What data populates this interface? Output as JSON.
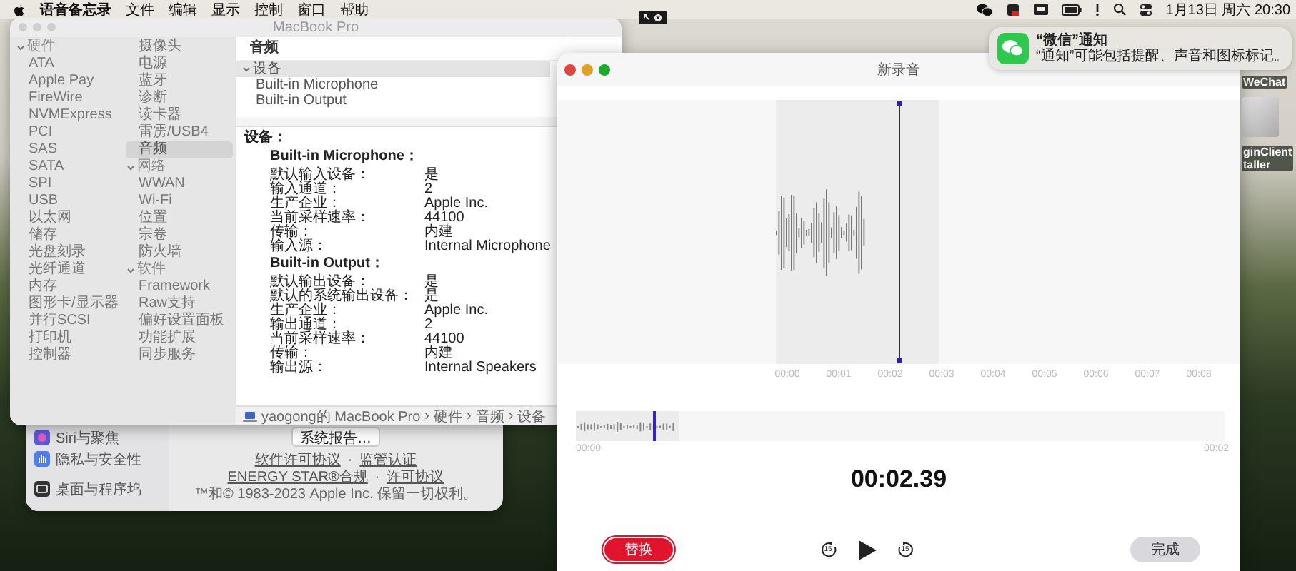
{
  "menu_bar": {
    "app_name": "语音备忘录",
    "menus": [
      "文件",
      "编辑",
      "显示",
      "控制",
      "窗口",
      "帮助"
    ],
    "clock": "1月13日 周六 20:30"
  },
  "notification": {
    "title": "“微信”通知",
    "body": "“通知”可能包括提醒、声音和图标标记。"
  },
  "desktop_icons": [
    {
      "kind": "label",
      "label_lines": [
        "WeChat"
      ]
    },
    {
      "kind": "installer",
      "label_lines": [
        "ginClient",
        "taller"
      ]
    }
  ],
  "system_settings": {
    "sidebar": [
      {
        "label": "Siri与聚焦",
        "kind": "siri"
      },
      {
        "label": "隐私与安全性",
        "kind": "privacy"
      },
      {
        "label": "桌面与程序坞",
        "kind": "desktop"
      }
    ],
    "report_button": "系统报告…",
    "link_rows": [
      [
        {
          "kind": "link",
          "text": "软件许可协议"
        },
        {
          "kind": "separator",
          "text": "·"
        },
        {
          "kind": "link",
          "text": "监管认证"
        }
      ],
      [
        {
          "kind": "link",
          "text": "ENERGY STAR®合规"
        },
        {
          "kind": "separator",
          "text": "·"
        },
        {
          "kind": "link",
          "text": "许可协议"
        }
      ]
    ],
    "copyright": "™和© 1983-2023 Apple Inc. 保留一切权利。"
  },
  "system_information": {
    "window": {
      "title": "MacBook Pro"
    },
    "sidebar": {
      "items": [
        {
          "label": "硬件",
          "expanded": true,
          "children": [
            {
              "label": "ATA",
              "selected": false
            },
            {
              "label": "Apple Pay",
              "selected": false
            },
            {
              "label": "FireWire",
              "selected": false
            },
            {
              "label": "NVMExpress",
              "selected": false
            },
            {
              "label": "PCI",
              "selected": false
            },
            {
              "label": "SAS",
              "selected": false
            },
            {
              "label": "SATA",
              "selected": false
            },
            {
              "label": "SPI",
              "selected": false
            },
            {
              "label": "USB",
              "selected": false
            },
            {
              "label": "以太网",
              "selected": false
            },
            {
              "label": "储存",
              "selected": false
            },
            {
              "label": "光盘刻录",
              "selected": false
            },
            {
              "label": "光纤通道",
              "selected": false
            },
            {
              "label": "内存",
              "selected": false
            },
            {
              "label": "图形卡/显示器",
              "selected": false
            },
            {
              "label": "并行SCSI",
              "selected": false
            },
            {
              "label": "打印机",
              "selected": false
            },
            {
              "label": "控制器",
              "selected": false
            },
            {
              "label": "摄像头",
              "selected": false
            },
            {
              "label": "电源",
              "selected": false
            },
            {
              "label": "蓝牙",
              "selected": false
            },
            {
              "label": "诊断",
              "selected": false
            },
            {
              "label": "读卡器",
              "selected": false
            },
            {
              "label": "雷雳/USB4",
              "selected": false
            },
            {
              "label": "音频",
              "selected": true
            }
          ]
        },
        {
          "label": "网络",
          "expanded": true,
          "children": [
            {
              "label": "WWAN",
              "selected": false
            },
            {
              "label": "Wi-Fi",
              "selected": false
            },
            {
              "label": "位置",
              "selected": false
            },
            {
              "label": "宗卷",
              "selected": false
            },
            {
              "label": "防火墙",
              "selected": false
            }
          ]
        },
        {
          "label": "软件",
          "expanded": true,
          "children": [
            {
              "label": "Framework",
              "selected": false
            },
            {
              "label": "Raw支持",
              "selected": false
            },
            {
              "label": "偏好设置面板",
              "selected": false
            },
            {
              "label": "功能扩展",
              "selected": false
            },
            {
              "label": "同步服务",
              "selected": false
            }
          ]
        }
      ]
    },
    "list": {
      "header": "音频",
      "rows": [
        {
          "label": "设备",
          "expanded": true,
          "selected": true,
          "children": [
            {
              "label": "Built-in Microphone",
              "selected": false
            },
            {
              "label": "Built-in Output",
              "selected": false
            }
          ]
        }
      ]
    },
    "details": {
      "heading": "设备：",
      "sections": [
        {
          "title": "Built-in Microphone：",
          "rows": [
            {
              "label": "默认输入设备：",
              "value": "是"
            },
            {
              "label": "输入通道：",
              "value": "2"
            },
            {
              "label": "生产企业：",
              "value": "Apple Inc."
            },
            {
              "label": "当前采样速率：",
              "value": "44100"
            },
            {
              "label": "传输：",
              "value": "内建"
            },
            {
              "label": "输入源：",
              "value": "Internal Microphone"
            }
          ]
        },
        {
          "title": "Built-in Output：",
          "rows": [
            {
              "label": "默认输出设备：",
              "value": "是"
            },
            {
              "label": "默认的系统输出设备：",
              "value": "是"
            },
            {
              "label": "生产企业：",
              "value": "Apple Inc."
            },
            {
              "label": "输出通道：",
              "value": "2"
            },
            {
              "label": "当前采样速率：",
              "value": "44100"
            },
            {
              "label": "传输：",
              "value": "内建"
            },
            {
              "label": "输出源：",
              "value": "Internal Speakers"
            }
          ]
        }
      ]
    },
    "path_bar": [
      "yaogong的 MacBook Pro",
      "›",
      "硬件",
      "›",
      "音频",
      "›",
      "设备"
    ]
  },
  "voice_memo": {
    "window": {
      "title": "新录音"
    },
    "timeline_labels": [
      "00:00",
      "00:01",
      "00:02",
      "00:03",
      "00:04",
      "00:05",
      "00:06",
      "00:07",
      "00:08"
    ],
    "overview": {
      "start": "00:00",
      "end": "00:02",
      "level": 0.12
    },
    "elapsed": "00:02.39",
    "skip_back": "15",
    "skip_forward": "15",
    "replace_button": "替换",
    "done_button": "完成"
  }
}
